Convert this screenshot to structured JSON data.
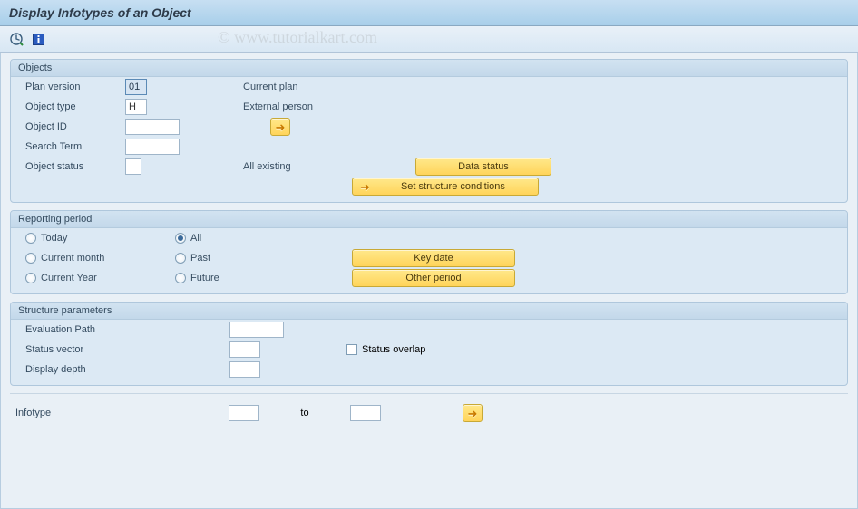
{
  "title": "Display Infotypes of an Object",
  "watermark": "© www.tutorialkart.com",
  "toolbar": {
    "execute_icon": "execute",
    "info_icon": "info"
  },
  "groups": {
    "objects": {
      "title": "Objects",
      "plan_version_label": "Plan version",
      "plan_version_value": "01",
      "plan_version_desc": "Current plan",
      "object_type_label": "Object type",
      "object_type_value": "H",
      "object_type_desc": "External person",
      "object_id_label": "Object ID",
      "object_id_value": "",
      "search_term_label": "Search Term",
      "search_term_value": "",
      "object_status_label": "Object status",
      "object_status_value": "",
      "object_status_desc": "All existing",
      "data_status_btn": "Data status",
      "set_structure_btn": "Set structure conditions"
    },
    "reporting": {
      "title": "Reporting period",
      "today": "Today",
      "all": "All",
      "current_month": "Current month",
      "past": "Past",
      "current_year": "Current Year",
      "future": "Future",
      "selected": "all",
      "key_date_btn": "Key date",
      "other_period_btn": "Other period"
    },
    "structure": {
      "title": "Structure parameters",
      "evaluation_path_label": "Evaluation Path",
      "evaluation_path_value": "",
      "status_vector_label": "Status vector",
      "status_vector_value": "",
      "status_overlap_label": "Status overlap",
      "status_overlap_checked": false,
      "display_depth_label": "Display depth",
      "display_depth_value": ""
    }
  },
  "infotype": {
    "label": "Infotype",
    "from_value": "",
    "to_label": "to",
    "to_value": ""
  }
}
